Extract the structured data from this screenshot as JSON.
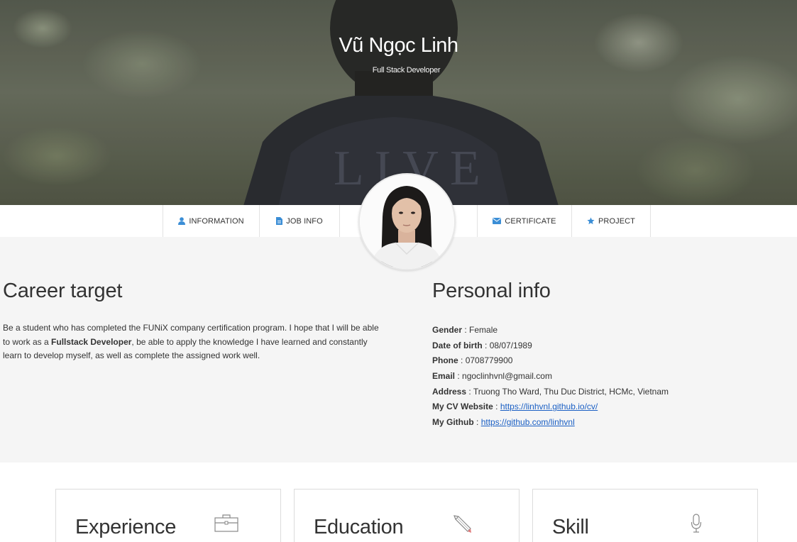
{
  "hero": {
    "name": "Vũ Ngọc Linh",
    "role": "Full Stack Developer"
  },
  "nav": {
    "items": [
      {
        "label": "INFORMATION",
        "icon": "user-icon"
      },
      {
        "label": "JOB INFO",
        "icon": "file-icon"
      },
      {
        "label": "CERTIFICATE",
        "icon": "envelope-icon"
      },
      {
        "label": "PROJECT",
        "icon": "star-icon"
      }
    ]
  },
  "colors": {
    "accent": "#3b8ed6",
    "link": "#1a5fc4",
    "section_bg": "#f5f5f5"
  },
  "career": {
    "title": "Career target",
    "text_before": "Be a student who has completed the FUNiX company certification program. I hope that I will be able to work as a ",
    "text_bold": "Fullstack Developer",
    "text_after": ", be able to apply the knowledge I have learned and constantly learn to develop myself, as well as complete the assigned work well."
  },
  "personal": {
    "title": "Personal info",
    "rows": [
      {
        "key": "Gender",
        "value": "Female"
      },
      {
        "key": "Date of birth",
        "value": "08/07/1989"
      },
      {
        "key": "Phone",
        "value": "0708779900"
      },
      {
        "key": "Email",
        "value": "ngoclinhvnl@gmail.com"
      },
      {
        "key": "Address",
        "value": "Truong Tho Ward, Thu Duc District, HCMc, Vietnam"
      },
      {
        "key": "My CV Website",
        "value": "https://linhvnl.github.io/cv/"
      },
      {
        "key": "My Github",
        "value": "https://github.com/linhvnl"
      }
    ]
  },
  "cards": [
    {
      "title": "Experience",
      "icon": "briefcase-icon"
    },
    {
      "title": "Education",
      "icon": "pencil-icon"
    },
    {
      "title": "Skill",
      "icon": "microphone-icon"
    }
  ]
}
